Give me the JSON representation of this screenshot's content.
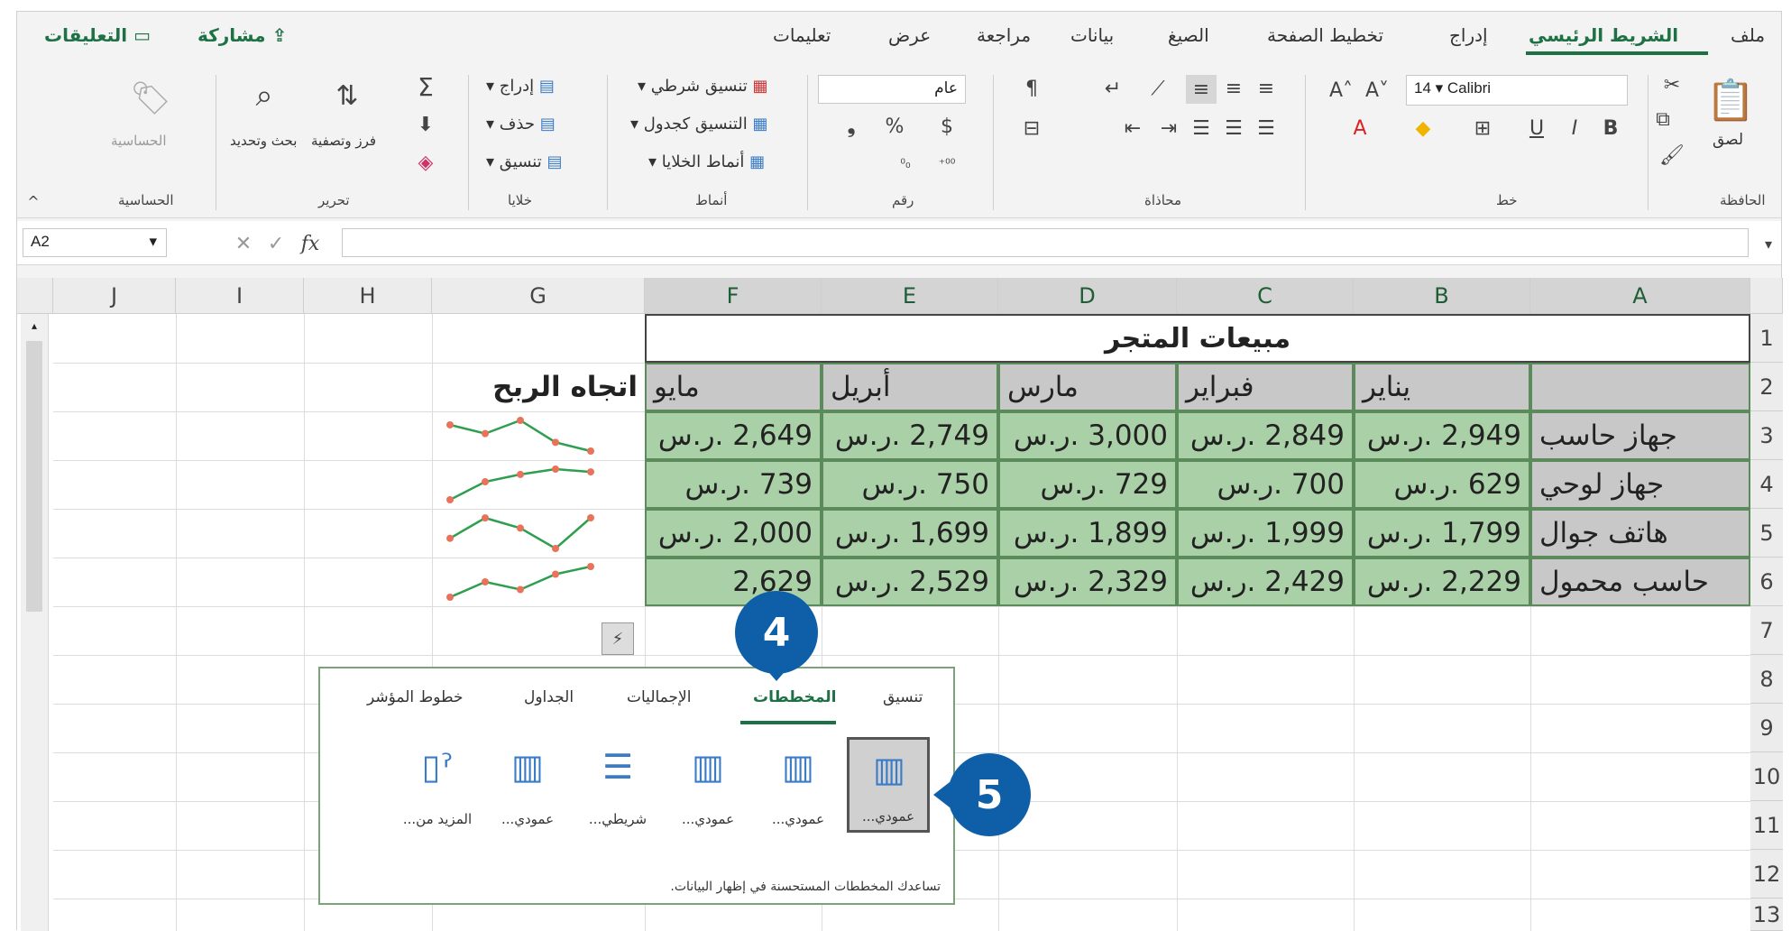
{
  "ribbon_tabs": [
    "ملف",
    "الشريط الرئيسي",
    "إدراج",
    "تخطيط الصفحة",
    "الصيغ",
    "بيانات",
    "مراجعة",
    "عرض",
    "تعليمات"
  ],
  "share": {
    "share_label": "مشاركة",
    "comments_label": "التعليقات"
  },
  "ribbon_groups": {
    "clipboard": "الحافظة",
    "font": "خط",
    "alignment": "محاذاة",
    "number": "رقم",
    "styles": "أنماط",
    "cells": "خلايا",
    "editing": "تحرير",
    "sensitivity": "الحساسية"
  },
  "ribbon_items": {
    "paste": "لصق",
    "font_name": "Calibri",
    "font_size": "14",
    "number_format": "عام",
    "conditional_formatting": "تنسيق شرطي",
    "format_as_table": "التنسيق كجدول",
    "cell_styles": "أنماط الخلايا",
    "insert": "إدراج",
    "delete": "حذف",
    "format": "تنسيق",
    "sort_filter": "فرز وتصفية",
    "find_select": "بحث وتحديد",
    "sensitivity": "الحساسية"
  },
  "formula_bar": {
    "name_box": "A2",
    "fx": "fx",
    "formula": ""
  },
  "columns": [
    "A",
    "B",
    "C",
    "D",
    "E",
    "F",
    "G",
    "H",
    "I",
    "J"
  ],
  "rows": [
    "1",
    "2",
    "3",
    "4",
    "5",
    "6",
    "7",
    "8",
    "9",
    "10",
    "11",
    "12",
    "13"
  ],
  "sheet": {
    "title": "مبيعات المتجر",
    "months": [
      "يناير",
      "فبراير",
      "مارس",
      "أبريل",
      "مايو"
    ],
    "trend_header": "اتجاه الربح",
    "products": [
      {
        "name": "جهاز حاسب",
        "values": [
          "2,949 .ر.س",
          "2,849 .ر.س",
          "3,000 .ر.س",
          "2,749 .ر.س",
          "2,649 .ر.س"
        ],
        "raw": [
          2949,
          2849,
          3000,
          2749,
          2649
        ]
      },
      {
        "name": "جهاز لوحي",
        "values": [
          "629 .ر.س",
          "700 .ر.س",
          "729 .ر.س",
          "750 .ر.س",
          "739 .ر.س"
        ],
        "raw": [
          629,
          700,
          729,
          750,
          739
        ]
      },
      {
        "name": "هاتف جوال",
        "values": [
          "1,799 .ر.س",
          "1,999 .ر.س",
          "1,899 .ر.س",
          "1,699 .ر.س",
          "2,000 .ر.س"
        ],
        "raw": [
          1799,
          1999,
          1899,
          1699,
          2000
        ]
      },
      {
        "name": "حاسب محمول",
        "values": [
          "2,229 .ر.س",
          "2,429 .ر.س",
          "2,329 .ر.س",
          "2,529 .ر.س",
          "2,629"
        ],
        "raw": [
          2229,
          2429,
          2329,
          2529,
          2629
        ]
      }
    ]
  },
  "quick_analysis": {
    "tabs": [
      "تنسيق",
      "المخططات",
      "الإجماليات",
      "الجداول",
      "خطوط المؤشر"
    ],
    "active_tab": "المخططات",
    "buttons": [
      "عمودي...",
      "عمودي...",
      "عمودي...",
      "شريطي...",
      "عمودي...",
      "المزيد من..."
    ],
    "footer": "تساعدك المخططات المستحسنة في إظهار البيانات."
  },
  "callouts": [
    "4",
    "5"
  ],
  "colors": {
    "accent": "#1e7145",
    "cell_green": "#a9d0a7",
    "header_grey": "#c8c8c8",
    "badge": "#0f5fa8",
    "sparkline": "#2e9e4f",
    "sparkline_marker": "#e8735a"
  }
}
